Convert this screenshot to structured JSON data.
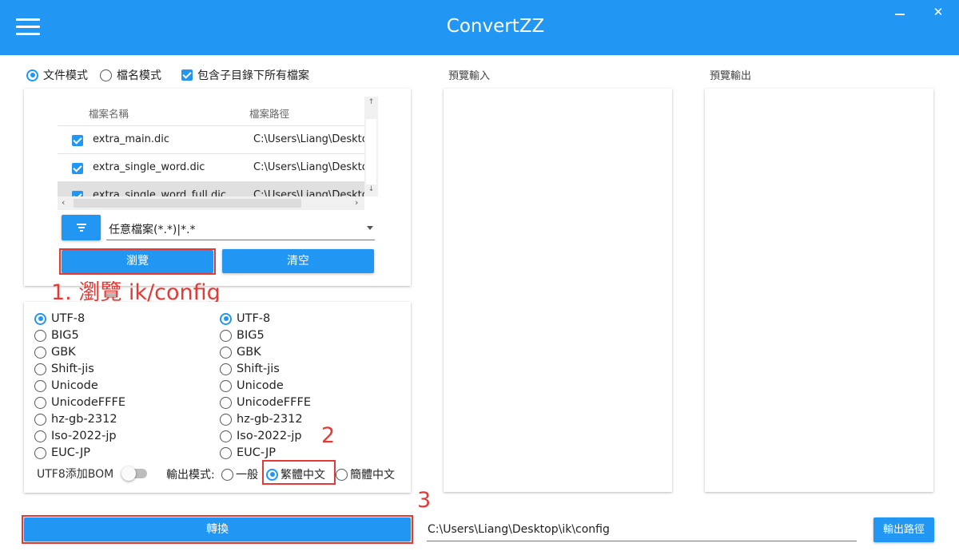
{
  "app": {
    "title": "ConvertZZ",
    "close_glyph": "✕"
  },
  "colors": {
    "accent": "#2196F3",
    "annotation": "#e53935"
  },
  "icons": {
    "menu": "hamburger-icon",
    "filter": "filter-icon",
    "minimize": "minimize-icon",
    "close": "close-icon"
  },
  "mode": {
    "file_mode": "文件模式",
    "name_mode": "檔名模式",
    "include_sub": "包含子目錄下所有檔案",
    "selected": "file_mode",
    "include_sub_checked": true
  },
  "grid": {
    "col_name": "檔案名稱",
    "col_path": "檔案路徑",
    "rows": [
      {
        "name": "extra_main.dic",
        "path": "C:\\Users\\Liang\\Desktop\\",
        "checked": true
      },
      {
        "name": "extra_single_word.dic",
        "path": "C:\\Users\\Liang\\Desktop\\",
        "checked": true
      },
      {
        "name": "extra_single_word_full.dic",
        "path": "C:\\Users\\Liang\\Desktop\\",
        "checked": true
      }
    ],
    "scroll_up": "↑",
    "scroll_down": "↓",
    "scroll_left": "‹",
    "scroll_right": "›"
  },
  "filter": {
    "value": "任意檔案(*.*)|*.*"
  },
  "buttons": {
    "browse": "瀏覽",
    "clear": "清空",
    "convert": "轉換",
    "output_path": "輸出路徑"
  },
  "annotations": {
    "step1": "1. 瀏覽 ik/config",
    "step2": "2",
    "step3": "3"
  },
  "encodings": {
    "input": [
      "UTF-8",
      "BIG5",
      "GBK",
      "Shift-jis",
      "Unicode",
      "UnicodeFFFE",
      "hz-gb-2312",
      "Iso-2022-jp",
      "EUC-JP"
    ],
    "output": [
      "UTF-8",
      "BIG5",
      "GBK",
      "Shift-jis",
      "Unicode",
      "UnicodeFFFE",
      "hz-gb-2312",
      "Iso-2022-jp",
      "EUC-JP"
    ],
    "input_selected": "UTF-8",
    "output_selected": "UTF-8"
  },
  "options": {
    "bom_label": "UTF8添加BOM",
    "bom_on": false,
    "output_mode_label": "輸出模式:",
    "general": "一般",
    "traditional": "繁體中文",
    "simplified": "簡體中文",
    "output_mode_selected": "traditional"
  },
  "preview": {
    "input_label": "預覽輸入",
    "output_label": "預覽輸出"
  },
  "output": {
    "path": "C:\\Users\\Liang\\Desktop\\ik\\config"
  }
}
